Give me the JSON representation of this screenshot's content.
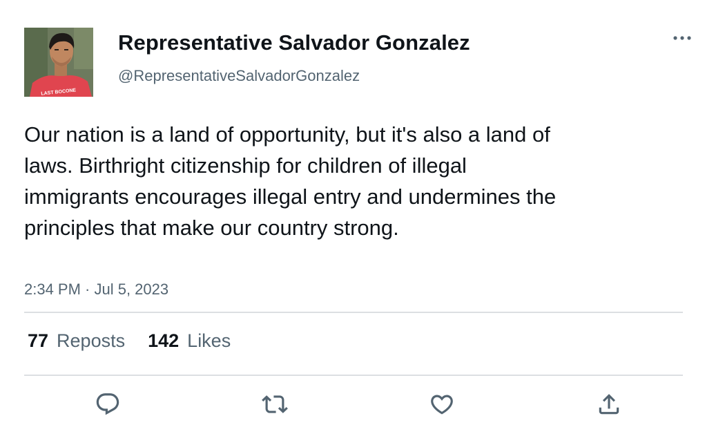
{
  "author": {
    "display_name": "Representative Salvador Gonzalez",
    "handle": "@RepresentativeSalvadorGonzalez",
    "avatar_shirt_text": "LAST BOCONE"
  },
  "tweet": {
    "text": "Our nation is a land of opportunity, but it's also a land of laws. Birthright citizenship for children of illegal immigrants encourages illegal entry and undermines the principles that make our country strong.",
    "timestamp": "2:34 PM · Jul 5, 2023"
  },
  "stats": {
    "reposts_count": "77",
    "reposts_label": "Reposts",
    "likes_count": "142",
    "likes_label": "Likes"
  },
  "actions": [
    {
      "name": "reply",
      "icon": "reply-icon"
    },
    {
      "name": "repost",
      "icon": "repost-icon"
    },
    {
      "name": "like",
      "icon": "heart-icon"
    },
    {
      "name": "share",
      "icon": "share-icon"
    }
  ],
  "colors": {
    "primary_text": "#0f1419",
    "secondary_text": "#536471",
    "divider": "#dcdfe2"
  }
}
